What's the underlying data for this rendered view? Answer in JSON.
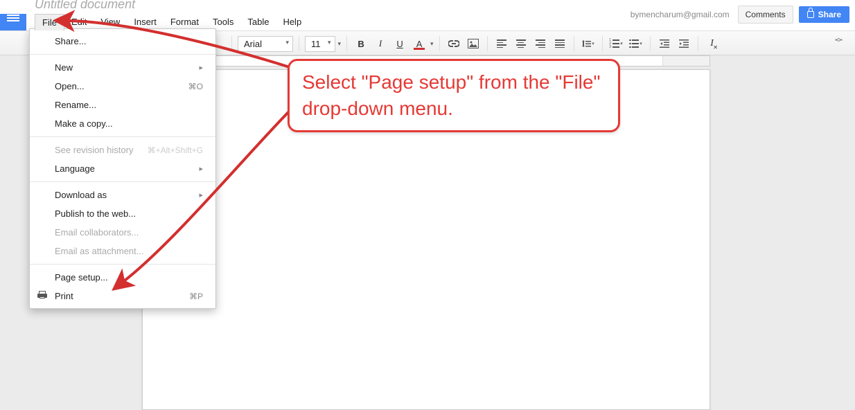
{
  "header": {
    "doc_title": "Untitled document",
    "email": "bymencharum@gmail.com",
    "comments_label": "Comments",
    "share_label": "Share"
  },
  "menubar": [
    "File",
    "Edit",
    "View",
    "Insert",
    "Format",
    "Tools",
    "Table",
    "Help"
  ],
  "toolbar": {
    "font_name": "Arial",
    "font_size": "11",
    "bold": "B",
    "italic": "I",
    "underline": "U",
    "text_color": "A",
    "link_icon": "link",
    "image_icon": "image",
    "align_left": "align-left",
    "align_center": "align-center",
    "align_right": "align-right",
    "align_justify": "align-justify",
    "line_spacing": "line-spacing",
    "numbered_list": "numbered-list",
    "bulleted_list": "bulleted-list",
    "indent_decrease": "indent-decrease",
    "indent_increase": "indent-increase",
    "clear_formatting": "clear-formatting"
  },
  "file_menu": {
    "share": "Share...",
    "new": "New",
    "open": "Open...",
    "open_shortcut": "⌘O",
    "rename": "Rename...",
    "make_copy": "Make a copy...",
    "revision_history": "See revision history",
    "revision_shortcut": "⌘+Alt+Shift+G",
    "language": "Language",
    "download_as": "Download as",
    "publish": "Publish to the web...",
    "email_collab": "Email collaborators...",
    "email_attach": "Email as attachment...",
    "page_setup": "Page setup...",
    "print": "Print",
    "print_shortcut": "⌘P"
  },
  "annotation": {
    "text": "Select \"Page setup\" from the \"File\" drop-down menu."
  }
}
